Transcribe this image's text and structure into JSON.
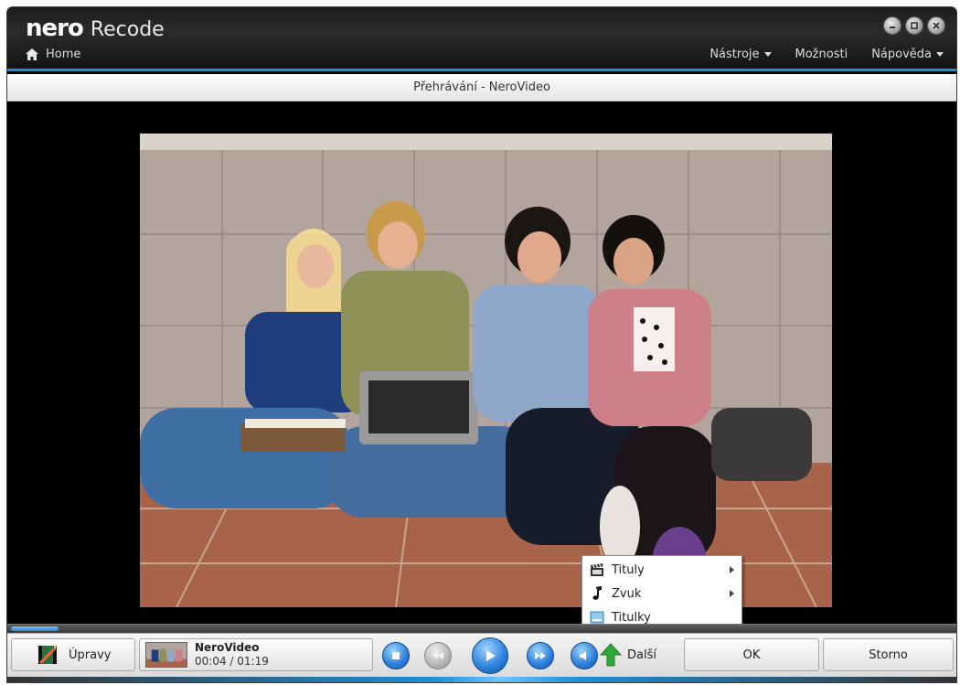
{
  "app": {
    "brand": "nero",
    "product": "Recode",
    "home_label": "Home"
  },
  "menus": [
    {
      "label": "Nástroje",
      "has_dropdown": true
    },
    {
      "label": "Možnosti",
      "has_dropdown": false
    },
    {
      "label": "Nápověda",
      "has_dropdown": true
    }
  ],
  "window_controls": [
    "minimize-icon",
    "restore-icon",
    "close-icon"
  ],
  "header": {
    "title": "Přehrávání - NeroVideo"
  },
  "context_menu": {
    "items": [
      {
        "label": "Tituly",
        "icon": "clapperboard-icon",
        "has_submenu": true
      },
      {
        "label": "Zvuk",
        "icon": "music-note-icon",
        "has_submenu": true
      },
      {
        "label": "Titulky",
        "icon": "subtitles-icon",
        "has_submenu": false
      }
    ]
  },
  "seek": {
    "progress": 0.05
  },
  "controls": {
    "edit_label": "Úpravy",
    "media_title": "NeroVideo",
    "media_time": "00:04 / 01:19",
    "next_label": "Další",
    "ok_label": "OK",
    "cancel_label": "Storno"
  },
  "colors": {
    "accent": "#1f8fd6",
    "titlebar": "#1d1d1d",
    "transport_blue": "#2a7fd9"
  }
}
